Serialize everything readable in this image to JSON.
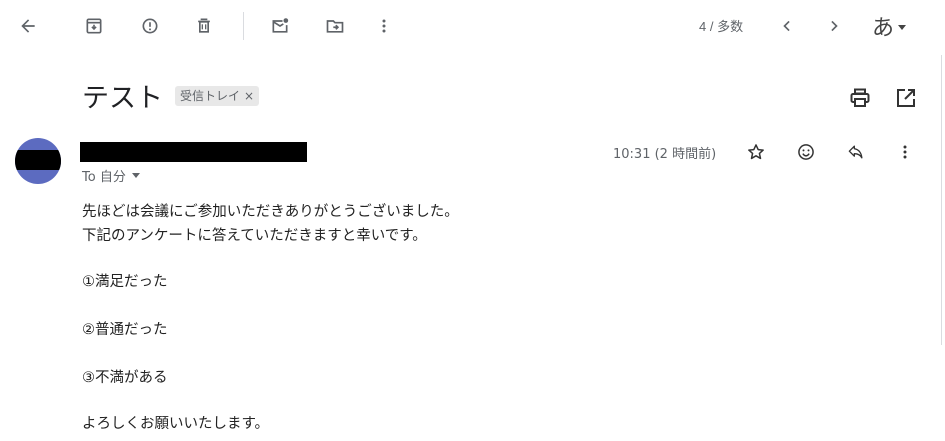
{
  "toolbar": {
    "counter": "4 / 多数",
    "ime_label": "あ"
  },
  "message": {
    "subject": "テスト",
    "label_chip": "受信トレイ",
    "label_remove": "×",
    "to": "To 自分",
    "timestamp": "10:31 (2 時間前)",
    "body_lines": [
      "先ほどは会議にご参加いただきありがとうございました。",
      "下記のアンケートに答えていただきますと幸いです。",
      "①満足だった",
      "②普通だった",
      "③不満がある",
      "よろしくお願いいたします。"
    ]
  },
  "colors": {
    "avatar": "#5c6bc0",
    "icon": "#5f6368"
  },
  "icons": [
    "arrow-back",
    "archive",
    "report-spam",
    "delete",
    "mark-unread",
    "move-to",
    "more-vert",
    "chevron-left",
    "chevron-right",
    "print",
    "open-in-new",
    "star",
    "emoji",
    "reply",
    "more-vert"
  ]
}
